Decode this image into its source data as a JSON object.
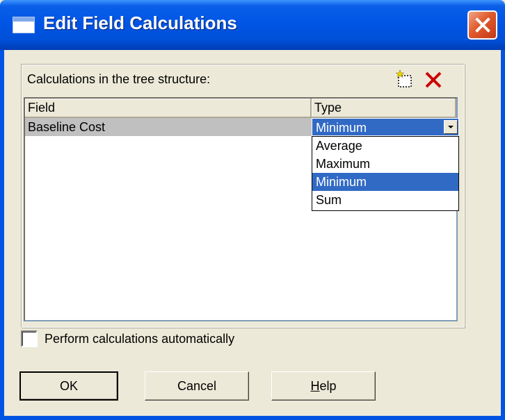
{
  "window": {
    "title": "Edit Field Calculations"
  },
  "group": {
    "label": "Calculations in the tree structure:",
    "toolbar": {
      "new_icon": "new-item-icon",
      "delete_icon": "delete-x-icon",
      "delete_color": "#CC0000"
    }
  },
  "table": {
    "headers": [
      "Field",
      "Type"
    ],
    "rows": [
      {
        "field": "Baseline Cost",
        "type": "Minimum"
      }
    ]
  },
  "type_dropdown": {
    "selected": "Minimum",
    "options": [
      "Average",
      "Maximum",
      "Minimum",
      "Sum"
    ],
    "highlighted_index": 2
  },
  "options": {
    "auto_calc_label": "Perform calculations automatically",
    "auto_calc_checked": false
  },
  "buttons": {
    "ok": "OK",
    "cancel": "Cancel",
    "help_first": "H",
    "help_rest": "elp"
  },
  "colors": {
    "title_bar": "#0055E5",
    "selection": "#316AC5",
    "dialog_bg": "#ECE9D8"
  }
}
